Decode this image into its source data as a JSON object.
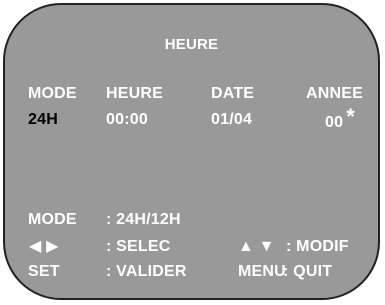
{
  "menu": {
    "title": "HEURE",
    "columns": [
      {
        "header": "MODE",
        "value": "24H"
      },
      {
        "header": "HEURE",
        "value": "00:00"
      },
      {
        "header": "DATE",
        "value": "01/04"
      },
      {
        "header": "ANNEE",
        "value": "00"
      }
    ],
    "cursor_marker": "*"
  },
  "legend": [
    {
      "key": "MODE",
      "action": ": 24H/12H"
    },
    {
      "key": "◀ ▶",
      "action": ": SELEC",
      "key2": "▲ ▼",
      "action2": ": MODIF"
    },
    {
      "key": "SET",
      "action": ": VALIDER",
      "key2": "MENU",
      "action2": ": QUIT"
    }
  ],
  "colors": {
    "background": "#999999",
    "text": "#ffffff",
    "selected": "#000000",
    "border": "#222222"
  }
}
